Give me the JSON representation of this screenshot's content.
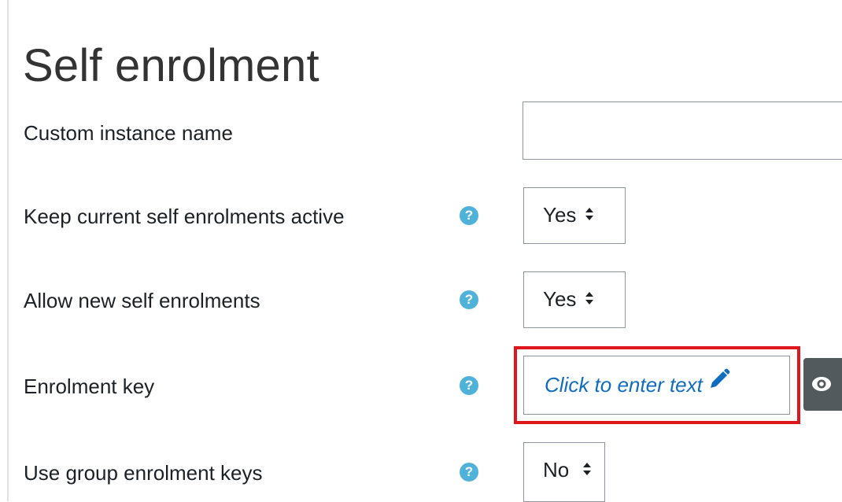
{
  "page": {
    "title": "Self enrolment"
  },
  "form": {
    "custom_instance_name": {
      "label": "Custom instance name",
      "value": ""
    },
    "keep_current_active": {
      "label": "Keep current self enrolments active",
      "selected": "Yes",
      "help_icon": "question-icon"
    },
    "allow_new": {
      "label": "Allow new self enrolments",
      "selected": "Yes",
      "help_icon": "question-icon"
    },
    "enrolment_key": {
      "label": "Enrolment key",
      "placeholder": "Click to enter text",
      "help_icon": "question-icon",
      "edit_icon": "pencil-icon",
      "reveal_icon": "eye-icon"
    },
    "group_keys": {
      "label": "Use group enrolment keys",
      "selected": "No",
      "help_icon": "question-icon"
    }
  },
  "colors": {
    "help_icon": "#4fb3d9",
    "link_blue": "#0f6cbf",
    "highlight_red": "#e0161e",
    "reveal_button": "#525a5e"
  }
}
